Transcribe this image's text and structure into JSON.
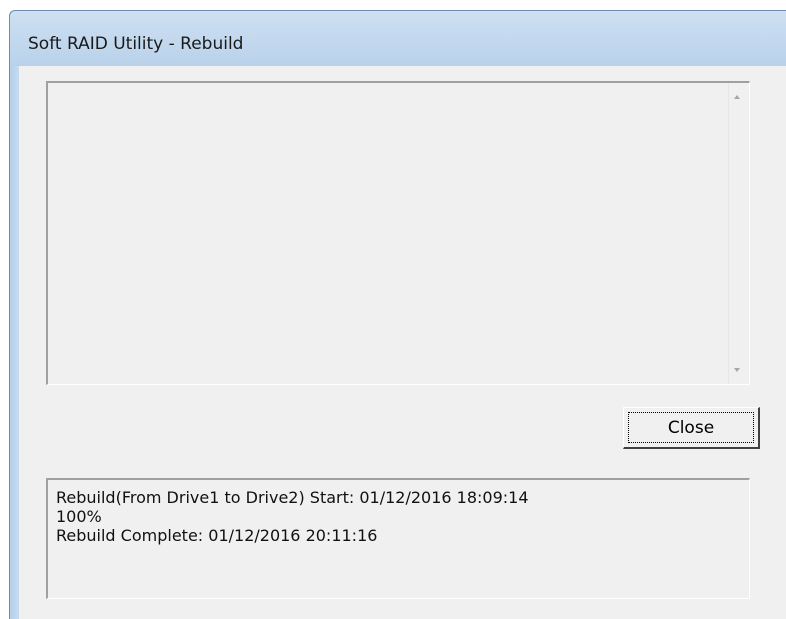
{
  "window": {
    "title": "Soft RAID Utility - Rebuild"
  },
  "buttons": {
    "close_label": "Close"
  },
  "status": {
    "lines": [
      "Rebuild(From Drive1 to Drive2) Start: 01/12/2016 18:09:14",
      "100%",
      "Rebuild Complete: 01/12/2016 20:11:16"
    ]
  },
  "icons": {
    "scroll_up": "scroll-up-arrow-icon",
    "scroll_down": "scroll-down-arrow-icon"
  },
  "colors": {
    "titlebar": "#c2d8ee",
    "client_bg": "#f0f0f0",
    "frame": "#bfd6ec"
  }
}
